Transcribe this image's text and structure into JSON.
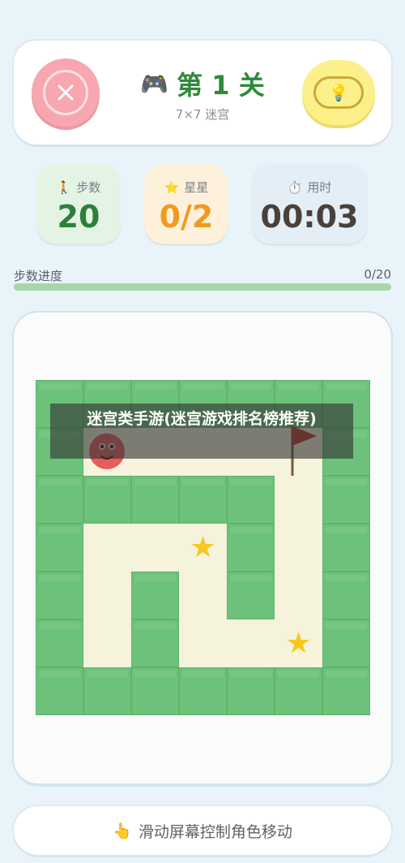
{
  "header": {
    "title": "第 1 关",
    "subtitle": "7×7 迷宫"
  },
  "stats": {
    "steps": {
      "label": "步数",
      "value": "20",
      "icon": "person-walking-icon"
    },
    "stars": {
      "label": "星星",
      "value": "0/2",
      "icon": "star-icon"
    },
    "time": {
      "label": "用时",
      "value": "00:03",
      "icon": "stopwatch-icon"
    }
  },
  "progress": {
    "label": "步数进度",
    "value_text": "0/20",
    "fraction": 0
  },
  "maze": {
    "size": 7,
    "grid": [
      "WWWWWWW",
      "WPFFFGW",
      "WWWWWFW",
      "WFFFWFW",
      "WFWFWFW",
      "WFWFFFW",
      "WWWWWWW"
    ],
    "stars": [
      [
        3,
        3
      ],
      [
        5,
        5
      ]
    ]
  },
  "overlay_text": "迷宫类手游(迷宫游戏排名榜推荐)",
  "footer": {
    "hint": "滑动屏幕控制角色移动",
    "icon": "pointing-hand-icon"
  },
  "colors": {
    "wall": "#6cc27a",
    "floor": "#f5f3dc",
    "star": "#f7c81f",
    "player": "#e85c5c",
    "flag": "#c0392b",
    "accent_green": "#2f8a3a",
    "close_button": "#f7a7ad",
    "hint_button": "#fbf08a"
  }
}
